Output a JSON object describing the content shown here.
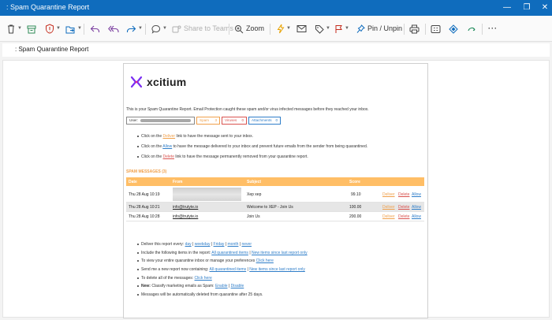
{
  "window": {
    "title": "Spam Quarantine Report",
    "title_prefix": ":"
  },
  "toolbar": {
    "share_to_teams": "Share to Teams",
    "zoom": "Zoom",
    "pin_unpin": "Pin / Unpin",
    "more": "···"
  },
  "subject": ": Spam Quarantine Report",
  "email": {
    "brand": "xcitium",
    "brand_color": "#7b2ff2",
    "intro": "This is your Spam Quarantine Report. Email Protection caught these spam and/or virus infected messages before they reached your inbox.",
    "summary": {
      "user_label": "User:",
      "spam_label": "Spam",
      "spam_count": "3",
      "viruses_label": "Viruses",
      "viruses_count": "0",
      "attachments_label": "Attachments",
      "attachments_count": "0"
    },
    "instructions": [
      {
        "pre": "Click on the ",
        "link": "Deliver",
        "post": " link to have the message sent to your inbox."
      },
      {
        "pre": "Click on the ",
        "link": "Allow",
        "post": " to have the message delivered to your inbox and prevent future emails from the sender from being quarantined."
      },
      {
        "pre": "Click on the ",
        "link": "Delete",
        "post": " link to have the message permanently removed from your quarantine report."
      }
    ],
    "spam_heading": "SPAM MESSAGES (3)",
    "table": {
      "headers": [
        "Date",
        "From",
        "Subject",
        "Score"
      ],
      "rows": [
        {
          "date": "Thu 28 Aug 10:19",
          "from": "",
          "subject": "Xep xep",
          "score": "99.10"
        },
        {
          "date": "Thu 28 Aug 10:21",
          "from": "info@trutyte.io",
          "subject": "Welcome to XEP - Join Us",
          "score": "100.00"
        },
        {
          "date": "Thu 28 Aug 10:28",
          "from": "info@trutyte.io",
          "subject": "Join Us",
          "score": "200.00"
        }
      ],
      "actions": {
        "deliver": "Deliver",
        "delete": "Delete",
        "allow": "Allow"
      }
    },
    "footer": {
      "deliver_pre": "Deliver this report every:",
      "deliver_opts": [
        "day",
        "weekday",
        "Friday",
        "month",
        "never"
      ],
      "include_pre": "Include the following items in the report:",
      "include_all": "All quarantined items",
      "include_new": "New items since last report only",
      "view_pre": "To view your entire quarantine inbox or manage your preferences",
      "view_link": "Click here",
      "send_pre": "Send me a new report now containing:",
      "send_all": "All quarantined items",
      "send_new": "New items since last report only",
      "delete_pre": "To delete all of the messages:",
      "delete_link": "Click here",
      "new_label": "New:",
      "classify_pre": "Classify marketing emails as Spam:",
      "enable": "Enable",
      "disable": "Disable",
      "auto_delete": "Messages will be automatically deleted from quarantine after 25 days."
    }
  }
}
